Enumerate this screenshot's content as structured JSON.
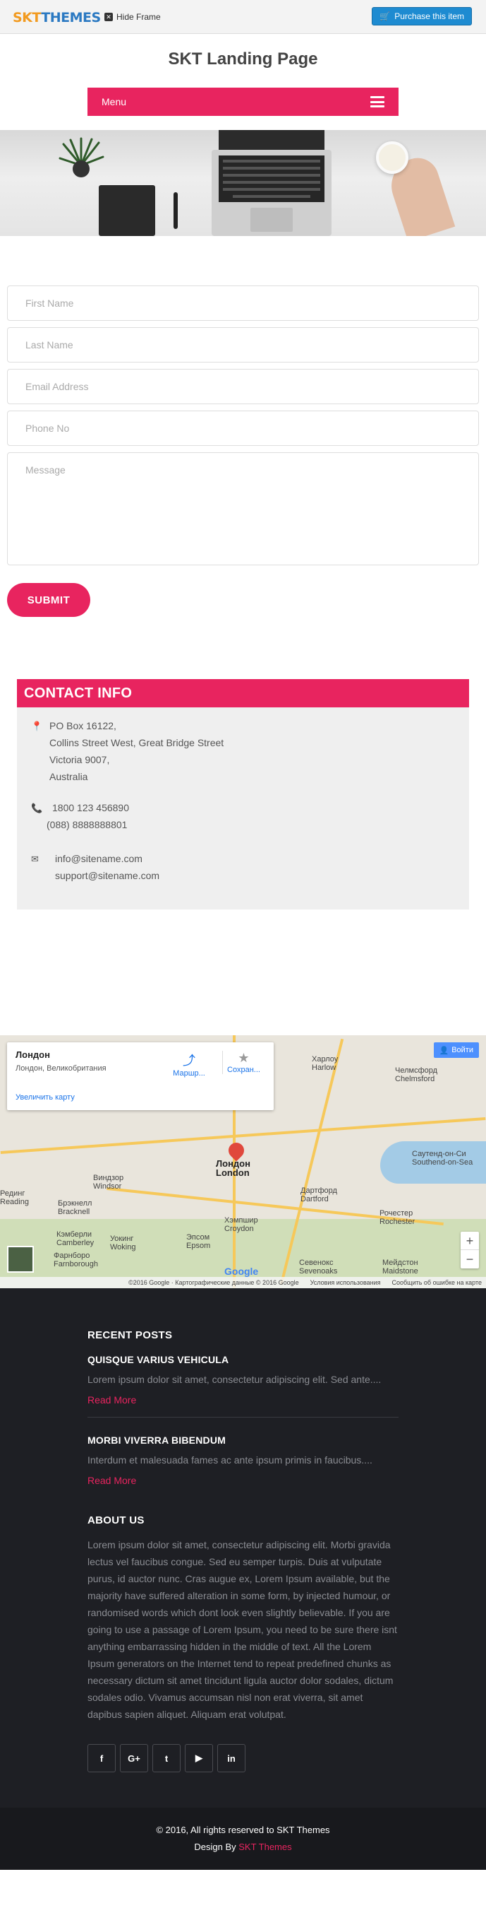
{
  "topbar": {
    "logo_part1": "SKT",
    "logo_part2": "THEMES",
    "hide_frame": "Hide Frame",
    "purchase": "Purchase this item"
  },
  "header": {
    "site_title": "SKT Landing Page",
    "menu_label": "Menu"
  },
  "form": {
    "first_name": "First Name",
    "last_name": "Last Name",
    "email": "Email Address",
    "phone": "Phone No",
    "message": "Message",
    "submit": "SUBMIT"
  },
  "contact": {
    "title": "CONTACT INFO",
    "address": [
      "PO Box 16122,",
      "Collins Street West, Great Bridge Street",
      "Victoria 9007,",
      "Australia"
    ],
    "phones": [
      "1800 123 456890",
      "(088) 8888888801"
    ],
    "emails": [
      "info@sitename.com",
      "support@sitename.com"
    ]
  },
  "map": {
    "place": "Лондон",
    "place_addr": "Лондон, Великобритания",
    "route": "Маршр...",
    "save": "Сохран...",
    "enlarge": "Увеличить карту",
    "signin": "Войти",
    "city_label_ru": "Лондон",
    "city_label_en": "London",
    "cities": [
      {
        "name": "Харлоу",
        "sub": "Harlow"
      },
      {
        "name": "Челмсфорд",
        "sub": "Chelmsford"
      },
      {
        "name": "Саутенд-он-Си",
        "sub": "Southend-on-Sea"
      },
      {
        "name": "Виндзор",
        "sub": "Windsor"
      },
      {
        "name": "Рединг",
        "sub": "Reading"
      },
      {
        "name": "Брэкнелл",
        "sub": "Bracknell"
      },
      {
        "name": "Дартфорд",
        "sub": "Dartford"
      },
      {
        "name": "Хэмпшир",
        "sub": "Croydon"
      },
      {
        "name": "Рочестер",
        "sub": "Rochester"
      },
      {
        "name": "Мейдстон",
        "sub": "Maidstone"
      },
      {
        "name": "Севенокс",
        "sub": "Sevenoaks"
      },
      {
        "name": "Уокинг",
        "sub": "Woking"
      },
      {
        "name": "Кэмберли",
        "sub": "Camberley"
      },
      {
        "name": "Фарнборо",
        "sub": "Farnborough"
      },
      {
        "name": "Эпсом",
        "sub": "Epsom"
      }
    ],
    "footer_data": "©2016 Google · Картографические данные © 2016 Google",
    "footer_terms": "Условия использования",
    "footer_report": "Сообщить об ошибке на карте",
    "google": "Google"
  },
  "footer": {
    "recent_title": "RECENT POSTS",
    "posts": [
      {
        "title": "QUISQUE VARIUS VEHICULA",
        "excerpt": "Lorem ipsum dolor sit amet, consectetur adipiscing elit. Sed ante....",
        "more": "Read More"
      },
      {
        "title": "MORBI VIVERRA BIBENDUM",
        "excerpt": "Interdum et malesuada fames ac ante ipsum primis in faucibus....",
        "more": "Read More"
      }
    ],
    "about_title": "ABOUT US",
    "about_text": "Lorem ipsum dolor sit amet, consectetur adipiscing elit. Morbi gravida lectus vel faucibus congue. Sed eu semper turpis. Duis at vulputate purus, id auctor nunc. Cras augue ex, Lorem Ipsum available, but the majority have suffered alteration in some form, by injected humour, or randomised words which dont look even slightly believable. If you are going to use a passage of Lorem Ipsum, you need to be sure there isnt anything embarrassing hidden in the middle of text. All the Lorem Ipsum generators on the Internet tend to repeat predefined chunks as necessary dictum sit amet tincidunt ligula auctor dolor sodales, dictum sodales odio. Vivamus accumsan nisl non erat viverra, sit amet dapibus sapien aliquet. Aliquam erat volutpat.",
    "social": [
      "f",
      "G+",
      "t",
      "▶",
      "in"
    ]
  },
  "bottom": {
    "copyright": "© 2016, All rights reserved to SKT Themes",
    "design_by": "Design By ",
    "brand": "SKT Themes"
  },
  "colors": {
    "accent": "#e8245f",
    "footer_bg": "#1e1f24",
    "purchase": "#1e8bd1"
  }
}
